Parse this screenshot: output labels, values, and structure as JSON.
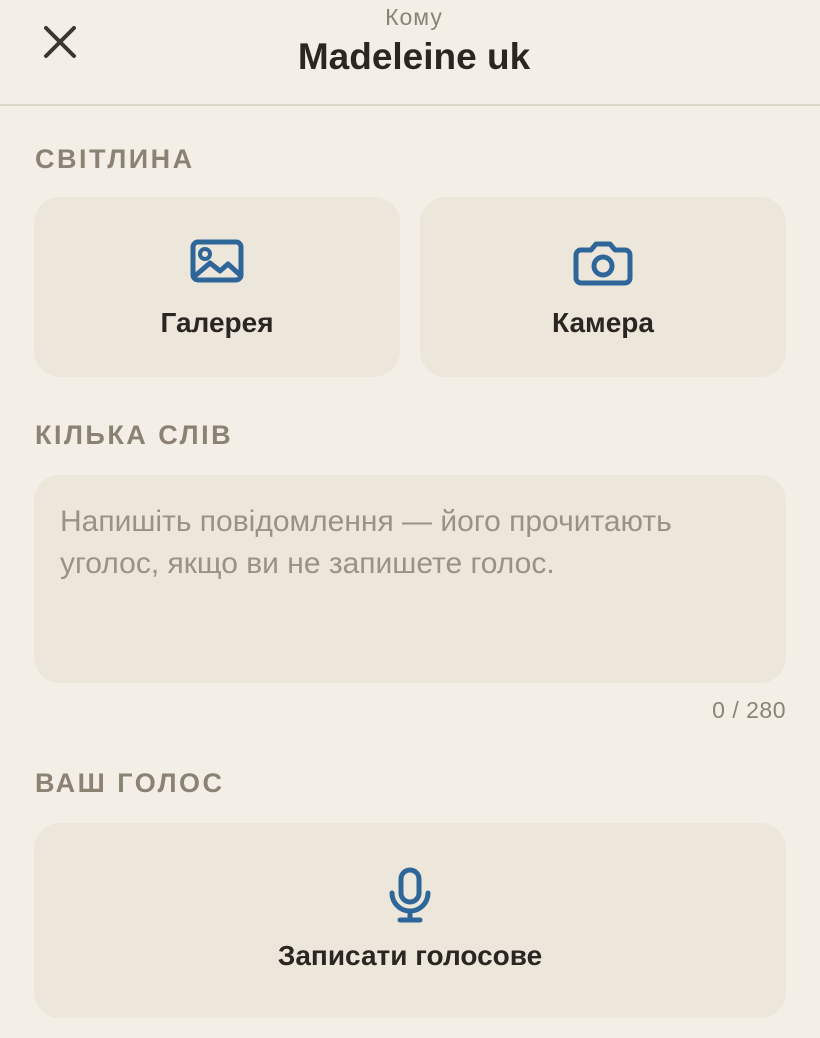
{
  "header": {
    "to_label": "Кому",
    "recipient": "Madeleine uk"
  },
  "photo_section": {
    "title": "СВІТЛИНА",
    "gallery_label": "Галерея",
    "camera_label": "Камера"
  },
  "message_section": {
    "title": "КІЛЬКА СЛІВ",
    "value": "",
    "placeholder": "Напишіть повідомлення — його прочитають уголос, якщо ви не запишете голос.",
    "counter": "0 / 280"
  },
  "voice_section": {
    "title": "ВАШ ГОЛОС",
    "record_label": "Записати голосове"
  },
  "icons": {
    "close": "close-icon",
    "gallery": "image-icon",
    "camera": "camera-icon",
    "voice": "microphone-icon"
  },
  "colors": {
    "background": "#f3efe7",
    "tile": "#ece6db",
    "accent_icon": "#2f6699",
    "section_label": "#8b8273",
    "text_primary": "#2b2621"
  }
}
